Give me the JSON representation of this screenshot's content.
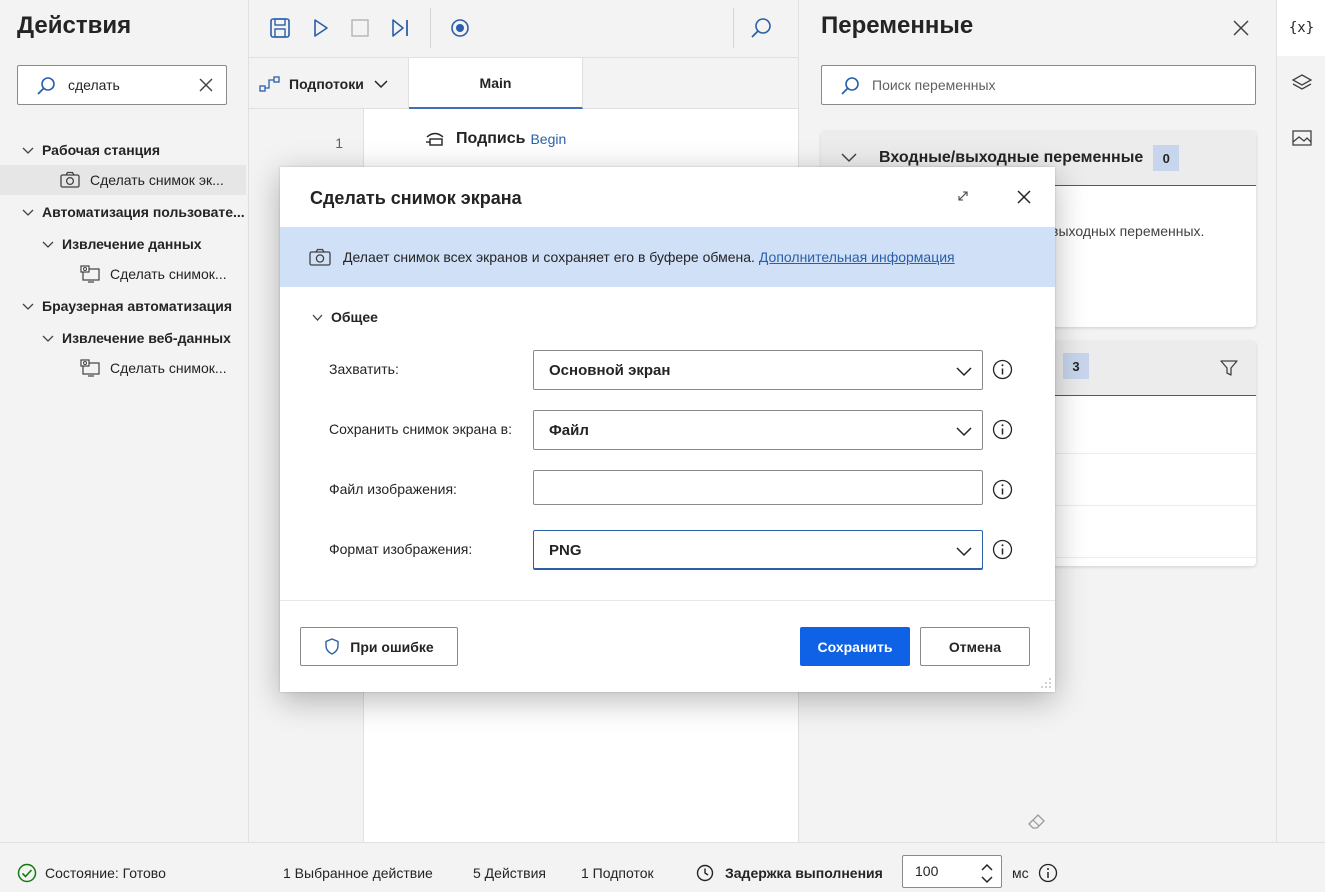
{
  "actions_pane": {
    "title": "Действия",
    "search_value": "сделать",
    "tree": [
      {
        "label": "Рабочая станция",
        "kind": "group"
      },
      {
        "label": "Сделать снимок эк...",
        "kind": "action",
        "icon": "camera-icon"
      },
      {
        "label": "Автоматизация пользовате...",
        "kind": "group"
      },
      {
        "label": "Извлечение данных",
        "kind": "subgroup"
      },
      {
        "label": "Сделать снимок...",
        "kind": "action",
        "icon": "screenshot-window-icon"
      },
      {
        "label": "Браузерная автоматизация",
        "kind": "group"
      },
      {
        "label": "Извлечение веб-данных",
        "kind": "subgroup"
      },
      {
        "label": "Сделать снимок...",
        "kind": "action",
        "icon": "screenshot-window-icon"
      }
    ]
  },
  "designer": {
    "toolbar_icons": [
      "save-icon",
      "run-icon",
      "stop-icon",
      "step-icon",
      "record-icon",
      "find-icon"
    ],
    "subflows_label": "Подпотоки",
    "tab_main": "Main",
    "line_number": "1",
    "step_title": "Подпись",
    "step_label": "Begin"
  },
  "variables_pane": {
    "title": "Переменные",
    "search_placeholder": "Поиск переменных",
    "io_section_title": "Входные/выходные переменные",
    "io_count": "0",
    "io_empty_text": "выходных переменных.",
    "flow_count": "3"
  },
  "status_bar": {
    "state": "Состояние: Готово",
    "selected_actions": "1 Выбранное действие",
    "actions_count": "5 Действия",
    "subflows_count": "1 Подпоток",
    "delay_label": "Задержка выполнения",
    "delay_value": "100",
    "delay_unit": "мс"
  },
  "dialog": {
    "title": "Сделать снимок экрана",
    "info_text": "Делает снимок всех экранов и сохраняет его в буфере обмена.",
    "info_link": "Дополнительная информация",
    "section_title": "Общее",
    "fields": {
      "capture_label": "Захватить:",
      "capture_value": "Основной экран",
      "save_to_label": "Сохранить снимок экрана в:",
      "save_to_value": "Файл",
      "image_file_label": "Файл изображения:",
      "image_file_value": "",
      "format_label": "Формат изображения:",
      "format_value": "PNG"
    },
    "on_error_label": "При ошибке",
    "save_label": "Сохранить",
    "cancel_label": "Отмена"
  },
  "colors": {
    "accent": "#0f62e6",
    "link": "#2b5fa8",
    "info_banner": "#cfe0f7",
    "badge": "#c7d6ed"
  }
}
